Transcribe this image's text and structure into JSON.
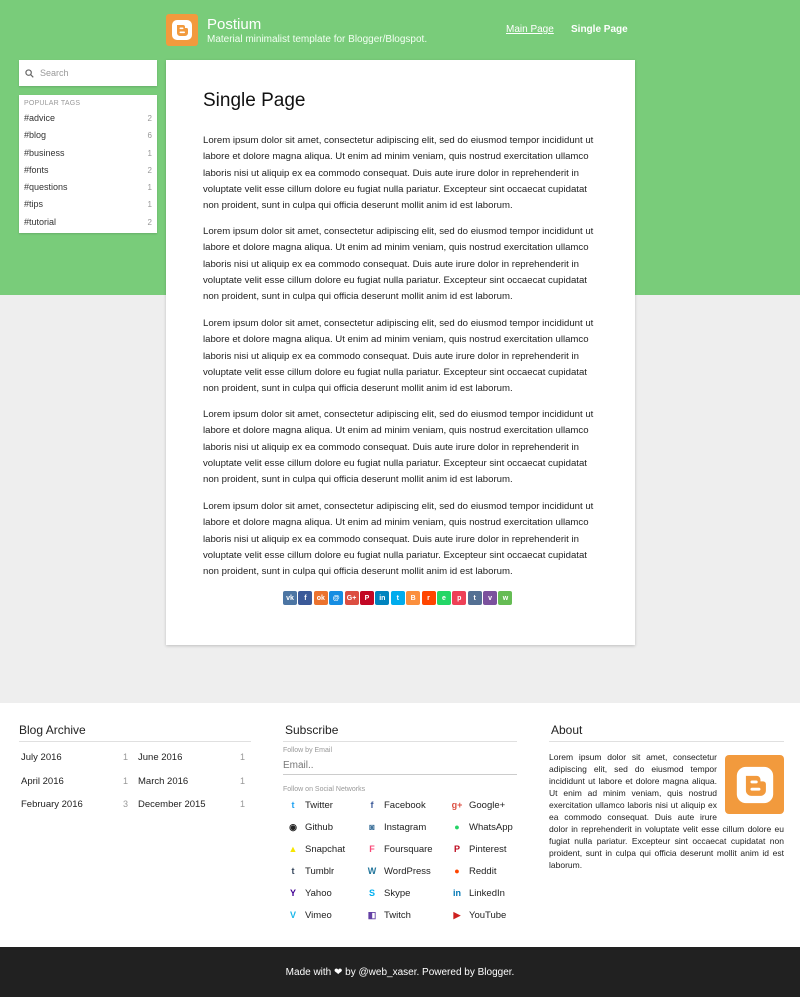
{
  "header": {
    "title": "Postium",
    "tagline": "Material minimalist template for Blogger/Blogspot.",
    "nav": {
      "main": "Main Page",
      "single": "Single Page"
    }
  },
  "sidebar": {
    "search_placeholder": "Search",
    "tags_title": "POPULAR TAGS",
    "tags": [
      {
        "label": "#advice",
        "count": "2"
      },
      {
        "label": "#blog",
        "count": "6"
      },
      {
        "label": "#business",
        "count": "1"
      },
      {
        "label": "#fonts",
        "count": "2"
      },
      {
        "label": "#questions",
        "count": "1"
      },
      {
        "label": "#tips",
        "count": "1"
      },
      {
        "label": "#tutorial",
        "count": "2"
      }
    ]
  },
  "main": {
    "title": "Single Page",
    "paragraphs": [
      "Lorem ipsum dolor sit amet, consectetur adipiscing elit, sed do eiusmod tempor incididunt ut labore et dolore magna aliqua. Ut enim ad minim veniam, quis nostrud exercitation ullamco laboris nisi ut aliquip ex ea commodo consequat. Duis aute irure dolor in reprehenderit in voluptate velit esse cillum dolore eu fugiat nulla pariatur. Excepteur sint occaecat cupidatat non proident, sunt in culpa qui officia deserunt mollit anim id est laborum.",
      "Lorem ipsum dolor sit amet, consectetur adipiscing elit, sed do eiusmod tempor incididunt ut labore et dolore magna aliqua. Ut enim ad minim veniam, quis nostrud exercitation ullamco laboris nisi ut aliquip ex ea commodo consequat. Duis aute irure dolor in reprehenderit in voluptate velit esse cillum dolore eu fugiat nulla pariatur. Excepteur sint occaecat cupidatat non proident, sunt in culpa qui officia deserunt mollit anim id est laborum.",
      "Lorem ipsum dolor sit amet, consectetur adipiscing elit, sed do eiusmod tempor incididunt ut labore et dolore magna aliqua. Ut enim ad minim veniam, quis nostrud exercitation ullamco laboris nisi ut aliquip ex ea commodo consequat. Duis aute irure dolor in reprehenderit in voluptate velit esse cillum dolore eu fugiat nulla pariatur. Excepteur sint occaecat cupidatat non proident, sunt in culpa qui officia deserunt mollit anim id est laborum.",
      "Lorem ipsum dolor sit amet, consectetur adipiscing elit, sed do eiusmod tempor incididunt ut labore et dolore magna aliqua. Ut enim ad minim veniam, quis nostrud exercitation ullamco laboris nisi ut aliquip ex ea commodo consequat. Duis aute irure dolor in reprehenderit in voluptate velit esse cillum dolore eu fugiat nulla pariatur. Excepteur sint occaecat cupidatat non proident, sunt in culpa qui officia deserunt mollit anim id est laborum.",
      "Lorem ipsum dolor sit amet, consectetur adipiscing elit, sed do eiusmod tempor incididunt ut labore et dolore magna aliqua. Ut enim ad minim veniam, quis nostrud exercitation ullamco laboris nisi ut aliquip ex ea commodo consequat. Duis aute irure dolor in reprehenderit in voluptate velit esse cillum dolore eu fugiat nulla pariatur. Excepteur sint occaecat cupidatat non proident, sunt in culpa qui officia deserunt mollit anim id est laborum."
    ],
    "share_icons": [
      {
        "name": "vk",
        "glyph": "vk",
        "color": "#4c75a3"
      },
      {
        "name": "facebook",
        "glyph": "f",
        "color": "#3b5998"
      },
      {
        "name": "odnoklassniki",
        "glyph": "ok",
        "color": "#eb722e"
      },
      {
        "name": "moimir",
        "glyph": "@",
        "color": "#168de2"
      },
      {
        "name": "googleplus",
        "glyph": "G+",
        "color": "#dc4e41"
      },
      {
        "name": "pinterest",
        "glyph": "P",
        "color": "#c20724"
      },
      {
        "name": "linkedin",
        "glyph": "in",
        "color": "#0083be"
      },
      {
        "name": "twitter",
        "glyph": "t",
        "color": "#00aced"
      },
      {
        "name": "blogger",
        "glyph": "B",
        "color": "#fb8f3d"
      },
      {
        "name": "reddit",
        "glyph": "r",
        "color": "#ff4500"
      },
      {
        "name": "evernote",
        "glyph": "e",
        "color": "#24d666"
      },
      {
        "name": "pocket",
        "glyph": "p",
        "color": "#ee4056"
      },
      {
        "name": "tumblr",
        "glyph": "t",
        "color": "#547093"
      },
      {
        "name": "viber",
        "glyph": "v",
        "color": "#7b519d"
      },
      {
        "name": "whatsapp",
        "glyph": "w",
        "color": "#65bc54"
      }
    ]
  },
  "archive": {
    "title": "Blog Archive",
    "items": [
      {
        "label": "July 2016",
        "count": "1"
      },
      {
        "label": "June 2016",
        "count": "1"
      },
      {
        "label": "April 2016",
        "count": "1"
      },
      {
        "label": "March 2016",
        "count": "1"
      },
      {
        "label": "February 2016",
        "count": "3"
      },
      {
        "label": "December 2015",
        "count": "1"
      }
    ]
  },
  "subscribe": {
    "title": "Subscribe",
    "follow_email": "Follow by Email",
    "email_placeholder": "Email..",
    "follow_social": "Follow on Social Networks",
    "networks": [
      {
        "label": "Twitter",
        "glyph": "t",
        "color": "#1da1f2"
      },
      {
        "label": "Facebook",
        "glyph": "f",
        "color": "#3b5998"
      },
      {
        "label": "Google+",
        "glyph": "g+",
        "color": "#dc4e41"
      },
      {
        "label": "Github",
        "glyph": "◉",
        "color": "#222222"
      },
      {
        "label": "Instagram",
        "glyph": "◙",
        "color": "#3f729b"
      },
      {
        "label": "WhatsApp",
        "glyph": "●",
        "color": "#25d366"
      },
      {
        "label": "Snapchat",
        "glyph": "▲",
        "color": "#f7e600"
      },
      {
        "label": "Foursquare",
        "glyph": "F",
        "color": "#f94877"
      },
      {
        "label": "Pinterest",
        "glyph": "P",
        "color": "#bd081c"
      },
      {
        "label": "Tumblr",
        "glyph": "t",
        "color": "#35465c"
      },
      {
        "label": "WordPress",
        "glyph": "W",
        "color": "#21759b"
      },
      {
        "label": "Reddit",
        "glyph": "●",
        "color": "#ff4500"
      },
      {
        "label": "Yahoo",
        "glyph": "Y",
        "color": "#410093"
      },
      {
        "label": "Skype",
        "glyph": "S",
        "color": "#00aff0"
      },
      {
        "label": "LinkedIn",
        "glyph": "in",
        "color": "#0077b5"
      },
      {
        "label": "Vimeo",
        "glyph": "V",
        "color": "#1ab7ea"
      },
      {
        "label": "Twitch",
        "glyph": "◧",
        "color": "#6441a5"
      },
      {
        "label": "YouTube",
        "glyph": "▶",
        "color": "#cd201f"
      }
    ]
  },
  "about": {
    "title": "About",
    "text": "Lorem ipsum dolor sit amet, consectetur adipiscing elit, sed do eiusmod tempor incididunt ut labore et dolore magna aliqua. Ut enim ad minim veniam, quis nostrud exercitation ullamco laboris nisi ut aliquip ex ea commodo consequat. Duis aute irure dolor in reprehenderit in voluptate velit esse cillum dolore eu fugiat nulla pariatur. Excepteur sint occaecat cupidatat non proident, sunt in culpa qui officia deserunt mollit anim id est laborum."
  },
  "footer": {
    "text": "Made with ❤ by @web_xaser. Powered by Blogger."
  },
  "colors": {
    "header_green": "#79cc7a",
    "blogger_orange": "#f29a3d",
    "footer_dark": "#212121"
  }
}
